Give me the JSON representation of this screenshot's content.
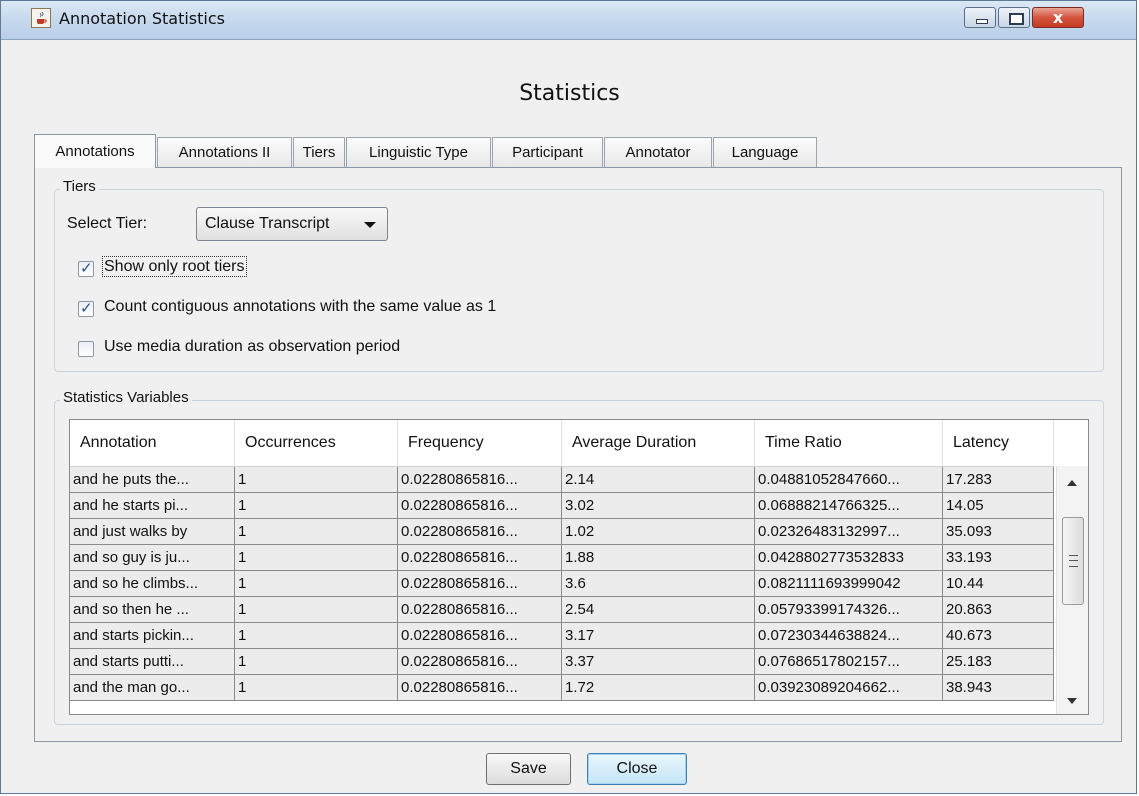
{
  "window": {
    "title": "Annotation Statistics",
    "buttons": {
      "minimize": "",
      "maximize": "",
      "close": "x"
    }
  },
  "heading": "Statistics",
  "tabs": [
    {
      "label": "Annotations",
      "active": true
    },
    {
      "label": "Annotations II",
      "active": false
    },
    {
      "label": "Tiers",
      "active": false
    },
    {
      "label": "Linguistic Type",
      "active": false
    },
    {
      "label": "Participant",
      "active": false
    },
    {
      "label": "Annotator",
      "active": false
    },
    {
      "label": "Language",
      "active": false
    }
  ],
  "tiers_group": {
    "title": "Tiers",
    "select_label": "Select Tier:",
    "select_value": "Clause Transcript",
    "checkboxes": [
      {
        "label": "Show only root tiers",
        "checked": true
      },
      {
        "label": "Count contiguous annotations with the same value as 1",
        "checked": true
      },
      {
        "label": "Use media duration as observation period",
        "checked": false
      }
    ]
  },
  "stats_group": {
    "title": "Statistics Variables",
    "columns": [
      "Annotation",
      "Occurrences",
      "Frequency",
      "Average Duration",
      "Time Ratio",
      "Latency"
    ],
    "rows": [
      [
        "and he puts the...",
        "1",
        "0.02280865816...",
        "2.14",
        "0.04881052847660...",
        "17.283"
      ],
      [
        "and he starts pi...",
        "1",
        "0.02280865816...",
        "3.02",
        "0.06888214766325...",
        "14.05"
      ],
      [
        "and just walks by",
        "1",
        "0.02280865816...",
        "1.02",
        "0.02326483132997...",
        "35.093"
      ],
      [
        "and so guy is ju...",
        "1",
        "0.02280865816...",
        "1.88",
        "0.0428802773532833",
        "33.193"
      ],
      [
        "and so he climbs...",
        "1",
        "0.02280865816...",
        "3.6",
        "0.0821111693999042",
        "10.44"
      ],
      [
        "and so then he ...",
        "1",
        "0.02280865816...",
        "2.54",
        "0.05793399174326...",
        "20.863"
      ],
      [
        "and starts pickin...",
        "1",
        "0.02280865816...",
        "3.17",
        "0.07230344638824...",
        "40.673"
      ],
      [
        "and starts putti...",
        "1",
        "0.02280865816...",
        "3.37",
        "0.07686517802157...",
        "25.183"
      ],
      [
        "and the man go...",
        "1",
        "0.02280865816...",
        "1.72",
        "0.03923089204662...",
        "38.943"
      ]
    ]
  },
  "footer": {
    "save_label": "Save",
    "close_label": "Close"
  },
  "icons": {
    "app": "java-cup-icon",
    "scroll_up": "chevron-up-icon",
    "scroll_down": "chevron-down-icon",
    "dropdown": "caret-down-icon"
  }
}
